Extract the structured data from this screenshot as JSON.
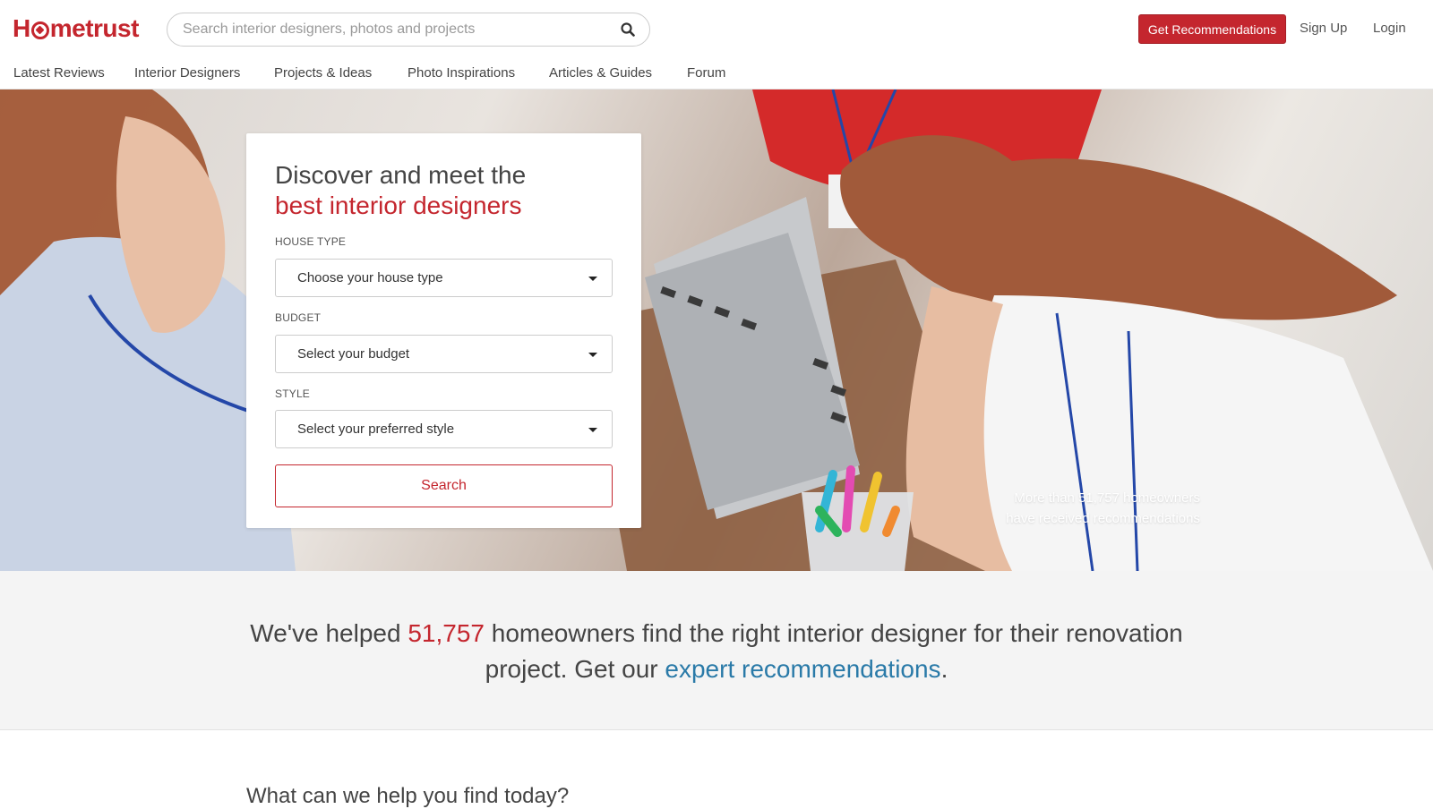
{
  "brand": {
    "logo_pre": "H",
    "logo_post": "metrust",
    "accent_color": "#c4262e",
    "link_color": "#2a7aa8"
  },
  "search": {
    "placeholder": "Search interior designers, photos and projects",
    "icon": "search-icon"
  },
  "header_actions": {
    "recommend_label": "Get Recommendations",
    "signup_label": "Sign Up",
    "login_label": "Login"
  },
  "nav": {
    "items": [
      {
        "label": "Latest Reviews"
      },
      {
        "label": "Interior Designers"
      },
      {
        "label": "Projects & Ideas"
      },
      {
        "label": "Photo Inspirations"
      },
      {
        "label": "Articles & Guides"
      },
      {
        "label": "Forum"
      }
    ]
  },
  "hero": {
    "title_line1": "Discover and meet the",
    "title_line2": "best interior designers",
    "fields": [
      {
        "label": "HOUSE TYPE",
        "value": "Choose your house type"
      },
      {
        "label": "BUDGET",
        "value": "Select your budget"
      },
      {
        "label": "STYLE",
        "value": "Select your preferred style"
      }
    ],
    "search_label": "Search",
    "caption_line1": "More than 51,757 homeowners",
    "caption_line2": "have received recommendations"
  },
  "stats": {
    "pre": "We've helped ",
    "count": "51,757",
    "mid": " homeowners find the right interior designer for their renovation project. Get our ",
    "link": "expert recommendations",
    "post": "."
  },
  "help": {
    "title": "What can we help you find today?"
  }
}
